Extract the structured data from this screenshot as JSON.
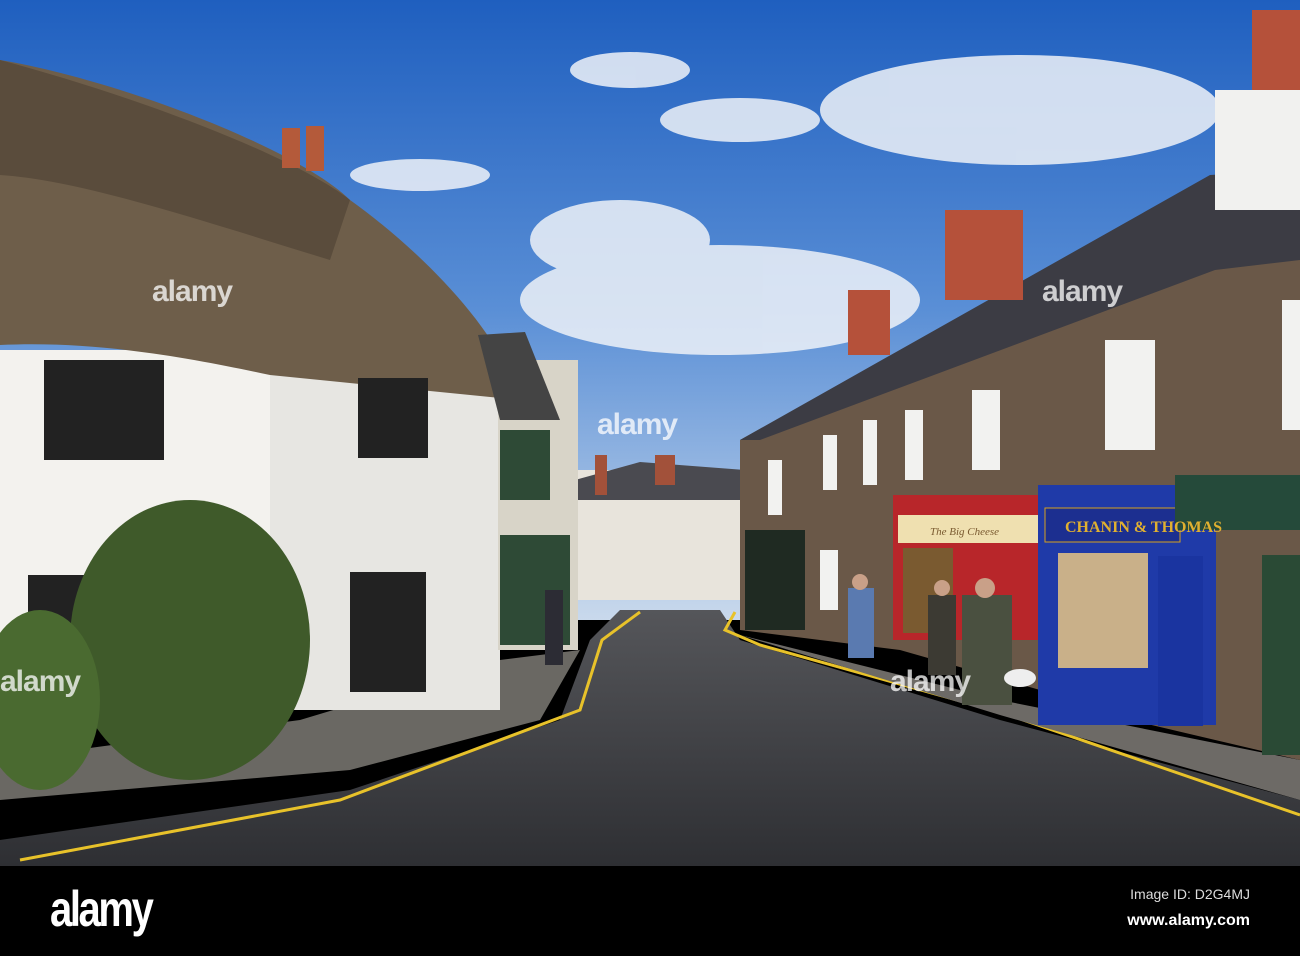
{
  "photo": {
    "shop_signs": [
      "CHANIN & THOMAS",
      "The Big Cheese"
    ],
    "colors": {
      "sky": "#2f6fc4",
      "thatch": "#6e5e4a",
      "walls": "#f2f1ee",
      "stone": "#6a5848",
      "road": "#3a3a3e",
      "shopfront_blue": "#1f3aa8",
      "shopfront_red": "#b8262a",
      "line": "#e8c22a"
    }
  },
  "watermark": {
    "text": "alamy"
  },
  "footer": {
    "logo": "alamy",
    "image_id": "Image ID: D2G4MJ",
    "website": "www.alamy.com"
  }
}
